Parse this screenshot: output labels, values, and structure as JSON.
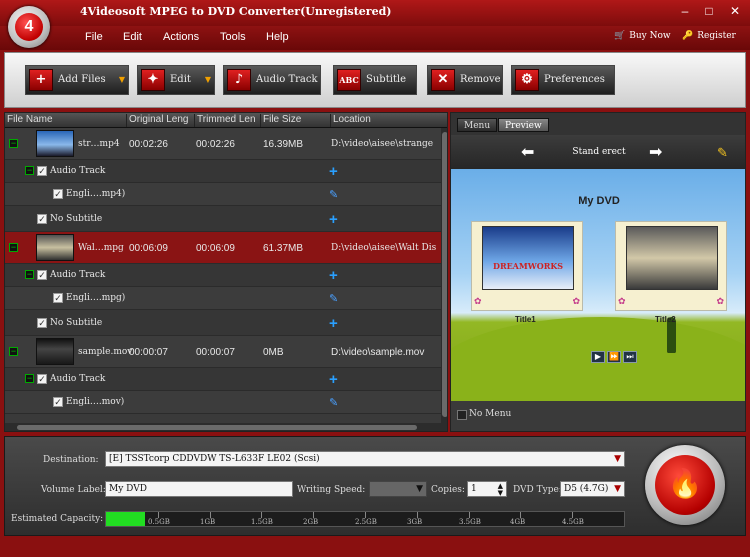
{
  "window": {
    "title": "4Videosoft MPEG to DVD Converter(Unregistered)",
    "logo_glyph": "4",
    "controls": {
      "minimize": "–",
      "maximize": "□",
      "close": "✕"
    }
  },
  "menu": {
    "items": [
      "File",
      "Edit",
      "Actions",
      "Tools",
      "Help"
    ],
    "buy_now": "Buy Now",
    "register": "Register"
  },
  "toolbar": {
    "add_files": "Add Files",
    "edit": "Edit",
    "audio_track": "Audio Track",
    "subtitle": "Subtitle",
    "remove": "Remove",
    "preferences": "Preferences",
    "subtitle_icon_text": "ABC"
  },
  "file_list": {
    "columns": [
      "File Name",
      "Original Leng",
      "Trimmed Len",
      "File Size",
      "Location"
    ],
    "files": [
      {
        "name": "str…mp4",
        "original": "00:02:26",
        "trimmed": "00:02:26",
        "size": "16.39MB",
        "location": "D:\\video\\aisee\\strange",
        "audio_label": "Audio Track",
        "audio_name": "Engli….mp4)",
        "subtitle_label": "No Subtitle"
      },
      {
        "name": "Wal…mpg",
        "original": "00:06:09",
        "trimmed": "00:06:09",
        "size": "61.37MB",
        "location": "D:\\video\\aisee\\Walt Dis",
        "audio_label": "Audio Track",
        "audio_name": "Engli….mpg)",
        "subtitle_label": "No Subtitle"
      },
      {
        "name": "sample.mov",
        "original": "00:00:07",
        "trimmed": "00:00:07",
        "size": "0MB",
        "location": "D:\\video\\sample.mov",
        "audio_label": "Audio Track",
        "audio_name": "Engli….mov)"
      }
    ]
  },
  "preview": {
    "tabs": [
      "Menu",
      "Preview"
    ],
    "nav_title": "Stand erect",
    "dvd_title": "My DVD",
    "thumb_labels": [
      "Title1",
      "Title2"
    ],
    "thumb_logo_text": "DREAMWORKS",
    "no_menu": "No Menu"
  },
  "bottom": {
    "destination_label": "Destination:",
    "destination_value": "[E] TSSTcorp CDDVDW TS-L633F LE02 (Scsi)",
    "volume_label": "Volume Label:",
    "volume_value": "My DVD",
    "writing_speed_label": "Writing Speed:",
    "writing_speed_value": "",
    "copies_label": "Copies:",
    "copies_value": "1",
    "dvd_type_label": "DVD Type:",
    "dvd_type_value": "D5 (4.7G)",
    "capacity_label": "Estimated Capacity:",
    "capacity_fraction": 0.075,
    "capacity_ticks": [
      "0.5GB",
      "1GB",
      "1.5GB",
      "2GB",
      "2.5GB",
      "3GB",
      "3.5GB",
      "4GB",
      "4.5GB"
    ]
  },
  "colors": {
    "frame_red": "#8a1010",
    "selected_row": "#8a1414",
    "capacity_fill": "#22dd22",
    "accent_blue": "#2aa0ff"
  }
}
